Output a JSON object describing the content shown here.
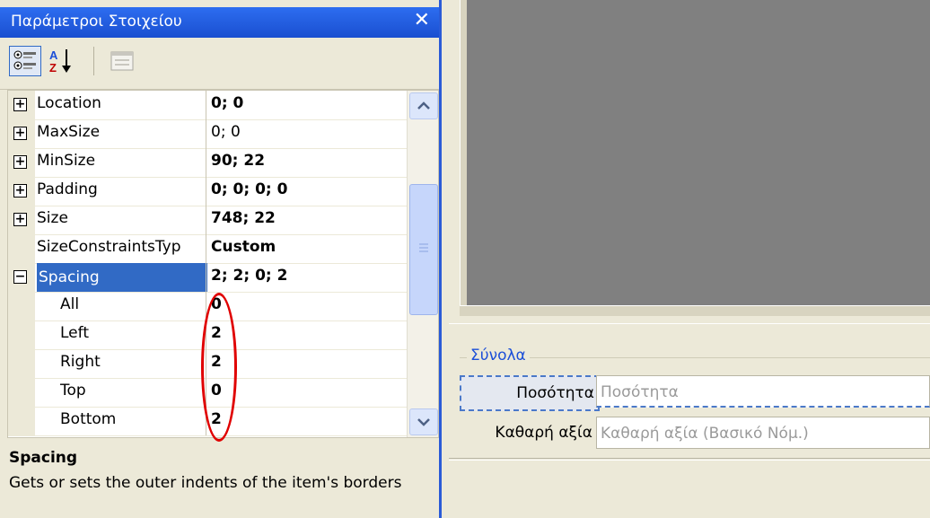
{
  "panel": {
    "title": "Παράμετροι Στοιχείου",
    "close_glyph": "✕",
    "toolbar": [
      "categorized-icon",
      "alphabetical-icon",
      "property-pages-icon"
    ]
  },
  "properties": [
    {
      "name": "Location",
      "value": "0; 0",
      "bold": true,
      "expander": "+"
    },
    {
      "name": "MaxSize",
      "value": "0; 0",
      "bold": false,
      "expander": "+"
    },
    {
      "name": "MinSize",
      "value": "90; 22",
      "bold": true,
      "expander": "+"
    },
    {
      "name": "Padding",
      "value": "0; 0; 0; 0",
      "bold": true,
      "expander": "+"
    },
    {
      "name": "Size",
      "value": "748; 22",
      "bold": true,
      "expander": "+"
    },
    {
      "name": "SizeConstraintsTyp",
      "value": "Custom",
      "bold": true,
      "expander": ""
    },
    {
      "name": "Spacing",
      "value": "2; 2; 0; 2",
      "bold": true,
      "expander": "-",
      "selected": true
    },
    {
      "name": "All",
      "value": "0",
      "bold": true,
      "sub": true
    },
    {
      "name": "Left",
      "value": "2",
      "bold": true,
      "sub": true
    },
    {
      "name": "Right",
      "value": "2",
      "bold": true,
      "sub": true
    },
    {
      "name": "Top",
      "value": "0",
      "bold": true,
      "sub": true
    },
    {
      "name": "Bottom",
      "value": "2",
      "bold": true,
      "sub": true
    }
  ],
  "description": {
    "heading": "Spacing",
    "text": "Gets or sets the outer indents of the item's borders"
  },
  "designer": {
    "group_title": "Σύνολα",
    "fields": [
      {
        "label": "Ποσότητα",
        "value": "Ποσότητα"
      },
      {
        "label": "Καθαρή αξία",
        "value": "Καθαρή αξία (Βασικό Νόμ.)"
      }
    ]
  },
  "colors": {
    "title_bar": "#1a4fd0",
    "selection": "#316ac5",
    "highlight_circle": "#e00000",
    "group_title": "#1c4fd8"
  }
}
